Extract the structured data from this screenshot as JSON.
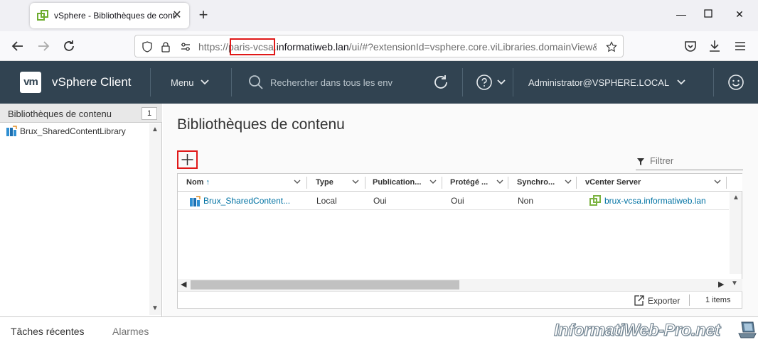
{
  "browser": {
    "tab_title": "vSphere - Bibliothèques de contenu",
    "url_prefix": "https://",
    "url_highlight": "paris-vcsa.",
    "url_host": "informatiweb.lan",
    "url_path": "/ui/#?extensionId=vsphere.core.viLibraries.domainView&fo"
  },
  "header": {
    "logo": "vm",
    "app_title": "vSphere Client",
    "menu_label": "Menu",
    "search_placeholder": "Rechercher dans tous les env",
    "user": "Administrator@VSPHERE.LOCAL"
  },
  "left": {
    "heading": "Bibliothèques de contenu",
    "count": "1",
    "items": [
      {
        "label": "Brux_SharedContentLibrary"
      }
    ]
  },
  "main": {
    "title": "Bibliothèques de contenu",
    "filter_placeholder": "Filtrer",
    "columns": [
      "Nom",
      "Type",
      "Publication...",
      "Protégé ...",
      "Synchro...",
      "vCenter Server"
    ],
    "rows": [
      {
        "name": "Brux_SharedContent...",
        "type": "Local",
        "publication": "Oui",
        "protege": "Oui",
        "synchro": "Non",
        "vcenter": "brux-vcsa.informatiweb.lan"
      }
    ],
    "export_label": "Exporter",
    "item_count": "1 items"
  },
  "bottom": {
    "recent_tasks": "Tâches récentes",
    "alarms": "Alarmes"
  },
  "watermark": "InformatiWeb-Pro.net",
  "colors": {
    "header_bg": "#314351",
    "link": "#0072a3",
    "highlight_box": "#e01818",
    "vsphere_green": "#7cb342"
  }
}
